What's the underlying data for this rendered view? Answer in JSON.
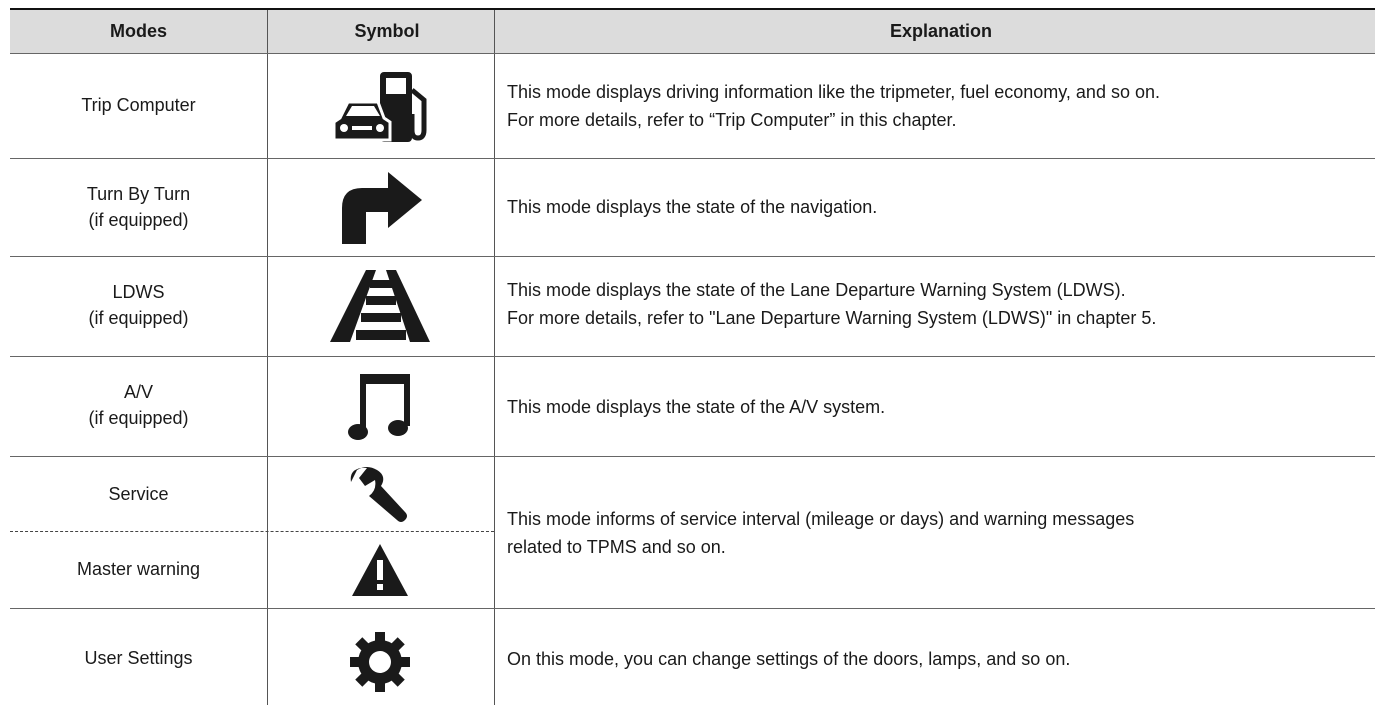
{
  "headers": {
    "modes": "Modes",
    "symbol": "Symbol",
    "explanation": "Explanation"
  },
  "rows": [
    {
      "mode": "Trip Computer",
      "mode_sub": "",
      "icon": "fuel-car-icon",
      "explanation": [
        "This mode displays driving information like the tripmeter, fuel economy, and so on.",
        "For more details, refer to “Trip Computer” in this chapter."
      ]
    },
    {
      "mode": "Turn By Turn",
      "mode_sub": "(if equipped)",
      "icon": "turn-right-arrow-icon",
      "explanation": [
        "This mode displays the state of the navigation."
      ]
    },
    {
      "mode": "LDWS",
      "mode_sub": "(if equipped)",
      "icon": "lane-departure-icon",
      "explanation": [
        "This mode displays the state of the Lane Departure Warning System (LDWS).",
        "For more details, refer to \"Lane Departure Warning System (LDWS)\" in chapter 5."
      ]
    },
    {
      "mode": "A/V",
      "mode_sub": "(if equipped)",
      "icon": "music-note-icon",
      "explanation": [
        "This mode displays the state of the A/V system."
      ]
    },
    {
      "mode": "Service",
      "mode_sub": "",
      "icon": "wrench-icon",
      "explanation": [
        "This mode informs of service interval (mileage or days) and warning messages",
        "related to TPMS and so on."
      ]
    },
    {
      "mode": "Master warning",
      "mode_sub": "",
      "icon": "warning-triangle-icon",
      "explanation": []
    },
    {
      "mode": "User Settings",
      "mode_sub": "",
      "icon": "gear-icon",
      "explanation": [
        "On this mode, you can change settings of the doors, lamps, and so on."
      ]
    }
  ],
  "colors": {
    "header_bg": "#dcdcdc",
    "icon": "#1a1a1a"
  }
}
